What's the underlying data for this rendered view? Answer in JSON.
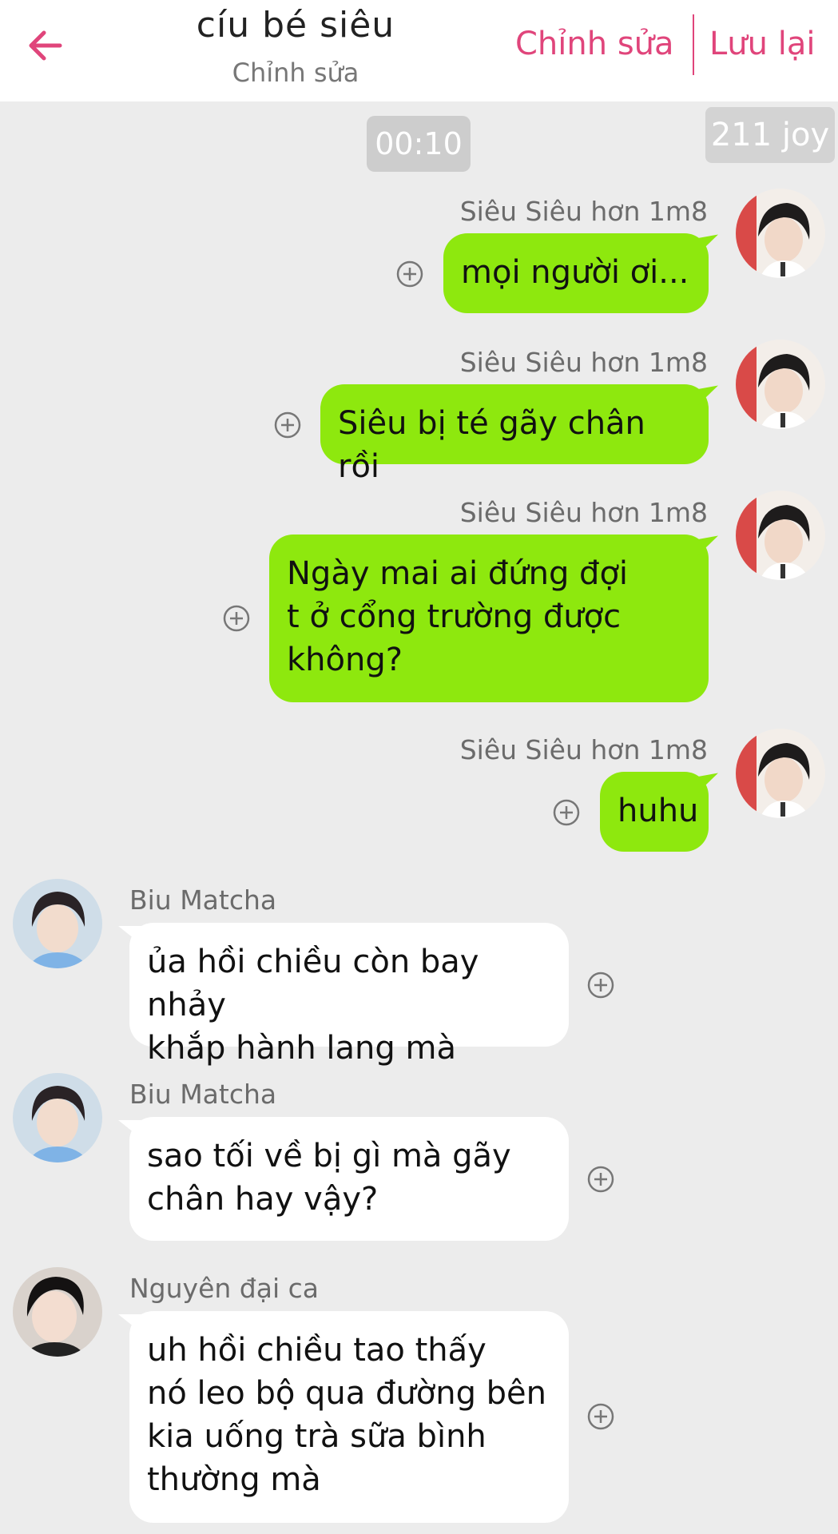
{
  "header": {
    "title": "cíu bé siêu",
    "subtitle": "Chỉnh sửa",
    "edit_label": "Chỉnh sửa",
    "save_label": "Lưu lại"
  },
  "badges": {
    "time": "00:10",
    "joy": "211 joy"
  },
  "messages": [
    {
      "sender": "Siêu Siêu hơn 1m8",
      "text": "mọi người ơi...",
      "side": "right"
    },
    {
      "sender": "Siêu Siêu hơn 1m8",
      "text": "Siêu bị té gãy chân rồi",
      "side": "right"
    },
    {
      "sender": "Siêu Siêu hơn 1m8",
      "text": "Ngày mai ai đứng đợi\nt ở cổng trường được\nkhông?",
      "side": "right"
    },
    {
      "sender": "Siêu Siêu hơn 1m8",
      "text": "huhu",
      "side": "right"
    },
    {
      "sender": "Biu Matcha",
      "text": "ủa hồi chiều còn bay nhảy\nkhắp hành lang mà",
      "side": "left"
    },
    {
      "sender": "Biu Matcha",
      "text": "sao tối về bị gì mà gãy\nchân hay vậy?",
      "side": "left"
    },
    {
      "sender": "Nguyên đại ca",
      "text": "uh hồi chiều tao thấy\nnó leo bộ qua đường bên\nkia uống trà sữa bình\nthường mà",
      "side": "left"
    }
  ],
  "colors": {
    "accent": "#e0457b",
    "bubble_green": "#8ee80e",
    "bubble_white": "#ffffff",
    "background": "#ececec"
  },
  "icons": {
    "back": "arrow-left-icon",
    "add": "plus-circle-icon"
  }
}
